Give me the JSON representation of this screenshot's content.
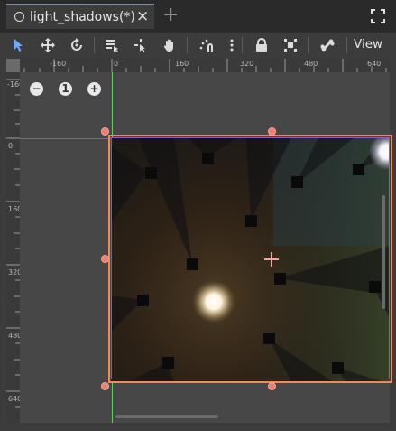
{
  "tab": {
    "title": "light_shadows(*)",
    "close_icon": "×",
    "add_icon": "+",
    "scene_icon": "circle-icon"
  },
  "toolbar": {
    "tools": [
      "select-tool-icon",
      "move-tool-icon",
      "rotate-tool-icon",
      "list-select-icon",
      "pivot-icon",
      "pan-hand-icon",
      "snap-icon",
      "more-icon",
      "lock-icon",
      "group-icon",
      "bone-icon"
    ],
    "view_label": "View"
  },
  "rulers": {
    "top_labels": [
      "-160",
      "0",
      "160",
      "320",
      "480",
      "640"
    ],
    "left_labels": [
      "-160",
      "0",
      "160",
      "320",
      "480",
      "640"
    ]
  },
  "zoom": {
    "minus": "−",
    "reset": "1",
    "plus": "+"
  },
  "colors": {
    "selection": "#f08a5d",
    "handle": "#f07e6e",
    "axis_x": "#c44c4c",
    "axis_y": "#6ec66e",
    "viewport_border": "#7b5fd6"
  }
}
